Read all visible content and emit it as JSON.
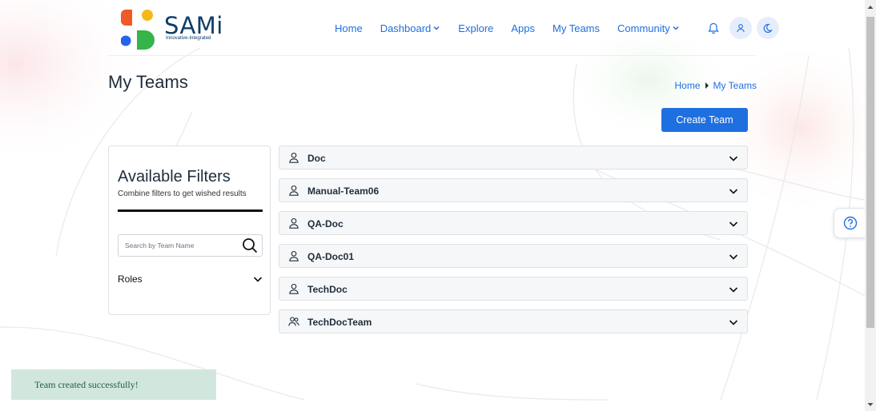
{
  "brand": {
    "name": "SAMi",
    "tagline": "Innovative-Integrated",
    "colors": {
      "orange": "#ef5a27",
      "yellow": "#f6b817",
      "blue": "#2563eb",
      "green": "#35b44a",
      "navy": "#0f3d6b"
    }
  },
  "nav": {
    "items": [
      {
        "label": "Home",
        "dropdown": false
      },
      {
        "label": "Dashboard",
        "dropdown": true
      },
      {
        "label": "Explore",
        "dropdown": false
      },
      {
        "label": "Apps",
        "dropdown": false
      },
      {
        "label": "My Teams",
        "dropdown": false
      },
      {
        "label": "Community",
        "dropdown": true
      }
    ],
    "icons": [
      "bell-icon",
      "user-icon",
      "moon-icon"
    ]
  },
  "page": {
    "title": "My Teams",
    "breadcrumb": [
      "Home",
      "My Teams"
    ],
    "create_button": "Create Team"
  },
  "filters": {
    "title": "Available Filters",
    "subtitle": "Combine filters to get wished results",
    "search_placeholder": "Search by Team Name",
    "search_value": "",
    "roles_label": "Roles"
  },
  "teams": [
    {
      "name": "Doc",
      "icon": "user-icon"
    },
    {
      "name": "Manual-Team06",
      "icon": "user-icon"
    },
    {
      "name": "QA-Doc",
      "icon": "user-icon"
    },
    {
      "name": "QA-Doc01",
      "icon": "user-icon"
    },
    {
      "name": "TechDoc",
      "icon": "user-icon"
    },
    {
      "name": "TechDocTeam",
      "icon": "users-icon"
    }
  ],
  "toast": {
    "message": "Team created successfully!"
  },
  "colors": {
    "accent": "#1e6fe0",
    "toast_bg": "#d1e7dd",
    "toast_text": "#285b46"
  }
}
